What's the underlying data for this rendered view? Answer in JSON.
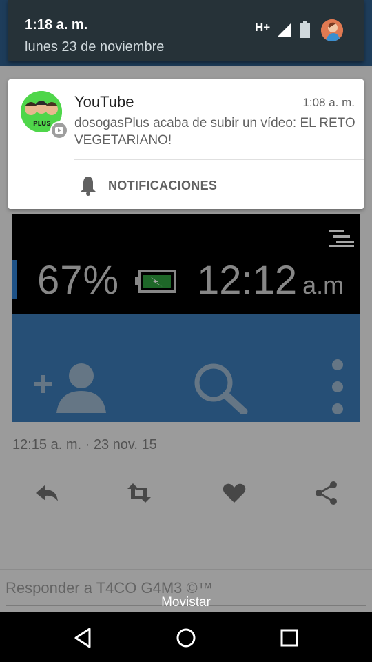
{
  "status_shade": {
    "time": "1:18 a. m.",
    "date": "lunes 23 de noviembre",
    "network_type": "H+",
    "icons": [
      "signal-icon",
      "battery-icon",
      "profile-avatar"
    ]
  },
  "notification": {
    "app_name": "YouTube",
    "time": "1:08 a. m.",
    "text": "dosogasPlus acaba de subir un vídeo: EL RETO VEGETARIANO!",
    "avatar_label": "PLUS",
    "action_label": "NOTIFICACIONES",
    "icons": [
      "youtube-badge-icon",
      "bell-icon"
    ]
  },
  "embedded_screenshot": {
    "battery_percent": "67%",
    "clock": "12:12",
    "clock_suffix": "a.m",
    "icons": [
      "menu-icon",
      "add-user-icon",
      "search-icon",
      "more-vert-icon",
      "battery-charging-icon"
    ]
  },
  "tweet": {
    "timestamp": "12:15 a. m. · 23 nov. 15",
    "actions": [
      "reply-icon",
      "retweet-icon",
      "like-icon",
      "share-icon"
    ],
    "reply_placeholder": "Responder a T4CO G4M3 ©™"
  },
  "carrier": "Movistar",
  "navigation": [
    "back-icon",
    "home-icon",
    "recents-icon"
  ],
  "colors": {
    "shade_header": "#263238",
    "app_bar": "#2f5f8c",
    "embedded_blue": "#3b7ab6",
    "avatar_green": "#4fd64a"
  }
}
